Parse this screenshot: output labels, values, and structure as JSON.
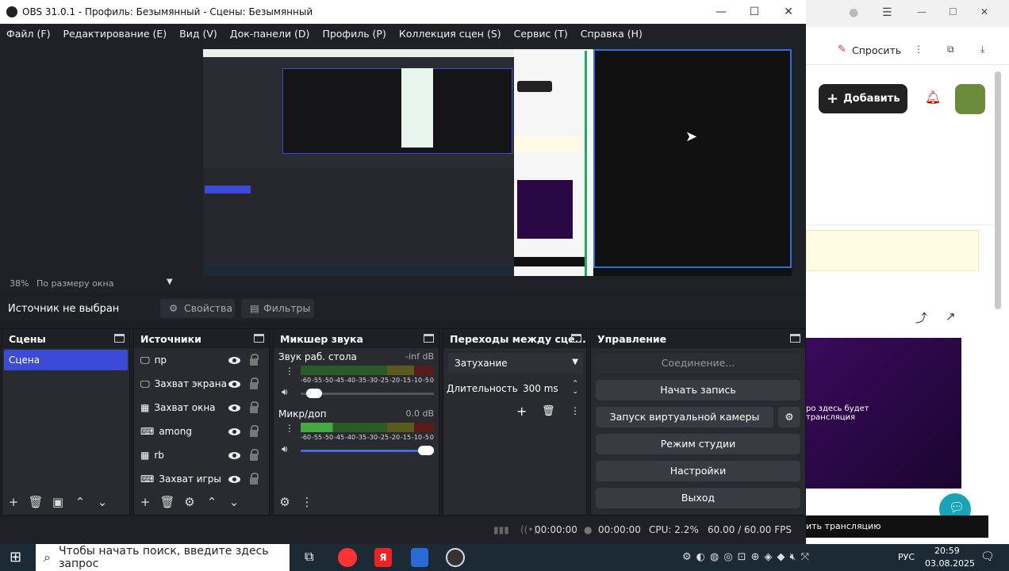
{
  "window": {
    "title": "OBS 31.0.1 - Профиль: Безымянный - Сцены: Безымянный",
    "minimize": "—",
    "maximize": "☐",
    "close": "✕"
  },
  "menu": [
    "Файл (F)",
    "Редактирование (E)",
    "Вид (V)",
    "Док-панели (D)",
    "Профиль (P)",
    "Коллекция сцен (S)",
    "Сервис (T)",
    "Справка (H)"
  ],
  "zoom": {
    "percent": "38%",
    "mode": "По размеру окна"
  },
  "source_bar": {
    "status": "Источник не выбран",
    "properties": "Свойства",
    "filters": "Фильтры"
  },
  "scenes": {
    "title": "Сцены",
    "items": [
      "Сцена"
    ]
  },
  "sources": {
    "title": "Источники",
    "items": [
      {
        "name": "пр",
        "icon": "monitor-icon"
      },
      {
        "name": "Захват экрана",
        "icon": "monitor-icon"
      },
      {
        "name": "Захват окна",
        "icon": "window-icon"
      },
      {
        "name": "among",
        "icon": "gamepad-icon"
      },
      {
        "name": "rb",
        "icon": "window-icon"
      },
      {
        "name": "Захват игры",
        "icon": "gamepad-icon"
      }
    ]
  },
  "mixer": {
    "title": "Микшер звука",
    "channels": [
      {
        "name": "Звук раб. стола",
        "db": "-inf dB",
        "volume": 0.05
      },
      {
        "name": "Микр/доп",
        "db": "0.0 dB",
        "volume": 1.0
      }
    ],
    "ticks": [
      "-60",
      "-55",
      "-50",
      "-45",
      "-40",
      "-35",
      "-30",
      "-25",
      "-20",
      "-15",
      "-10",
      "-5",
      "0"
    ]
  },
  "transitions": {
    "title": "Переходы между сце...",
    "selected": "Затухание",
    "duration_label": "Длительность",
    "duration": "300 ms"
  },
  "controls": {
    "title": "Управление",
    "connect": "Соединение...",
    "record": "Начать запись",
    "virtual_cam": "Запуск виртуальной камеры",
    "studio": "Режим студии",
    "settings": "Настройки",
    "exit": "Выход"
  },
  "status": {
    "stream_time": "00:00:00",
    "rec_time": "00:00:00",
    "cpu": "CPU: 2.2%",
    "fps": "60.00 / 60.00 FPS"
  },
  "browser": {
    "ask": "Спросить",
    "add": "Добавить",
    "stream_text": "ро здесь будет\nтрансляция",
    "start_stream": "ить трансляцию"
  },
  "taskbar": {
    "search_placeholder": "Чтобы начать поиск, введите здесь запрос",
    "lang": "РУС",
    "time": "20:59",
    "date": "03.08.2025",
    "notif": "1"
  },
  "colors": {
    "accent": "#3c4bd6",
    "obs_bg": "#1e1f24"
  }
}
